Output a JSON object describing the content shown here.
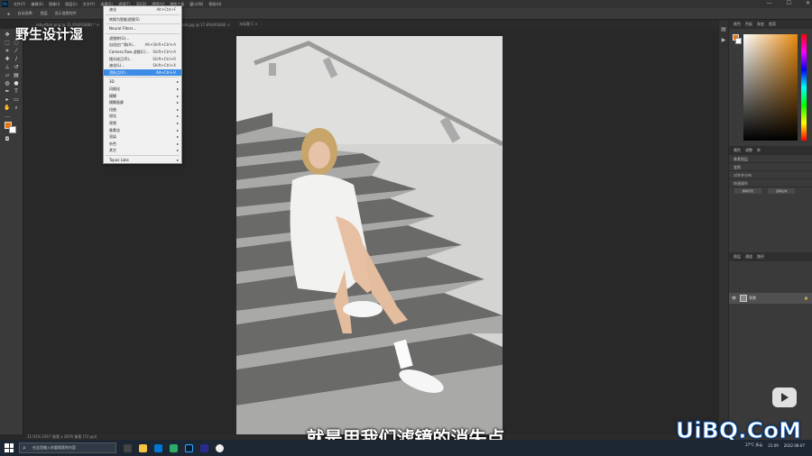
{
  "menubar": {
    "logo": "Ps",
    "items": [
      "文件(F)",
      "编辑(E)",
      "图像(I)",
      "图层(L)",
      "文字(Y)",
      "选择(S)",
      "滤镜(T)",
      "3D(D)",
      "视图(V)",
      "增效工具",
      "窗口(W)",
      "帮助(H)"
    ],
    "window_buttons": [
      "—",
      "☐",
      "✕"
    ]
  },
  "options_bar": {
    "items": [
      "自动选择:",
      "图层",
      "显示变换控件"
    ]
  },
  "tabs": [
    "...rebyrtbm.png @ 11.9%(RGB/8) * ×",
    "christopher-campbell-rAo4eP_tTDY-unsplash.jpg @ 17.8%(RGB/8) ×",
    "未标题-1 ×"
  ],
  "status_bar": "11.91%    1917 像素 x 2876 像素 (72 ppi)",
  "watermark": "野生设计湿",
  "subtitle": "就是用我们滤镜的消失点",
  "brand": "UiBQ.CoM",
  "filter_menu": {
    "items": [
      {
        "label": "液化",
        "shortcut": "Alt+Ctrl+F"
      },
      {
        "sep": true
      },
      {
        "label": "转换为智能滤镜(S)",
        "shortcut": ""
      },
      {
        "sep": true
      },
      {
        "label": "Neural Filters...",
        "shortcut": ""
      },
      {
        "sep": true
      },
      {
        "label": "滤镜库(G)...",
        "shortcut": ""
      },
      {
        "label": "自适应广角(A)...",
        "shortcut": "Alt+Shift+Ctrl+A"
      },
      {
        "label": "Camera Raw 滤镜(C)...",
        "shortcut": "Shift+Ctrl+A"
      },
      {
        "label": "镜头校正(R)...",
        "shortcut": "Shift+Ctrl+R"
      },
      {
        "label": "液化(L)...",
        "shortcut": "Shift+Ctrl+X"
      },
      {
        "label": "消失点(V)...",
        "shortcut": "Alt+Ctrl+V",
        "highlight": true
      },
      {
        "sep": true
      },
      {
        "label": "3D",
        "sub": true
      },
      {
        "label": "风格化",
        "sub": true
      },
      {
        "label": "模糊",
        "sub": true
      },
      {
        "label": "模糊画廊",
        "sub": true
      },
      {
        "label": "扭曲",
        "sub": true
      },
      {
        "label": "锐化",
        "sub": true
      },
      {
        "label": "视频",
        "sub": true
      },
      {
        "label": "像素化",
        "sub": true
      },
      {
        "label": "渲染",
        "sub": true
      },
      {
        "label": "杂色",
        "sub": true
      },
      {
        "label": "其它",
        "sub": true
      },
      {
        "sep": true
      },
      {
        "label": "Topaz Labs",
        "sub": true
      }
    ]
  },
  "panels": {
    "top_tabs": [
      "颜色",
      "色板",
      "渐变",
      "图案"
    ],
    "properties_tabs": [
      "属性",
      "调整",
      "库"
    ],
    "properties_rows": [
      "像素图层",
      "变换",
      "对齐并分布",
      "快速操作"
    ],
    "quick_buttons": [
      "删除背景",
      "选择主体"
    ],
    "layers_tabs": [
      "图层",
      "通道",
      "路径"
    ],
    "layer_name": "背景"
  },
  "taskbar": {
    "search_placeholder": "在这里输入你要搜索的内容",
    "tray_time": "21:09",
    "tray_date": "2022-08-07",
    "weather": "27°C 多云"
  }
}
